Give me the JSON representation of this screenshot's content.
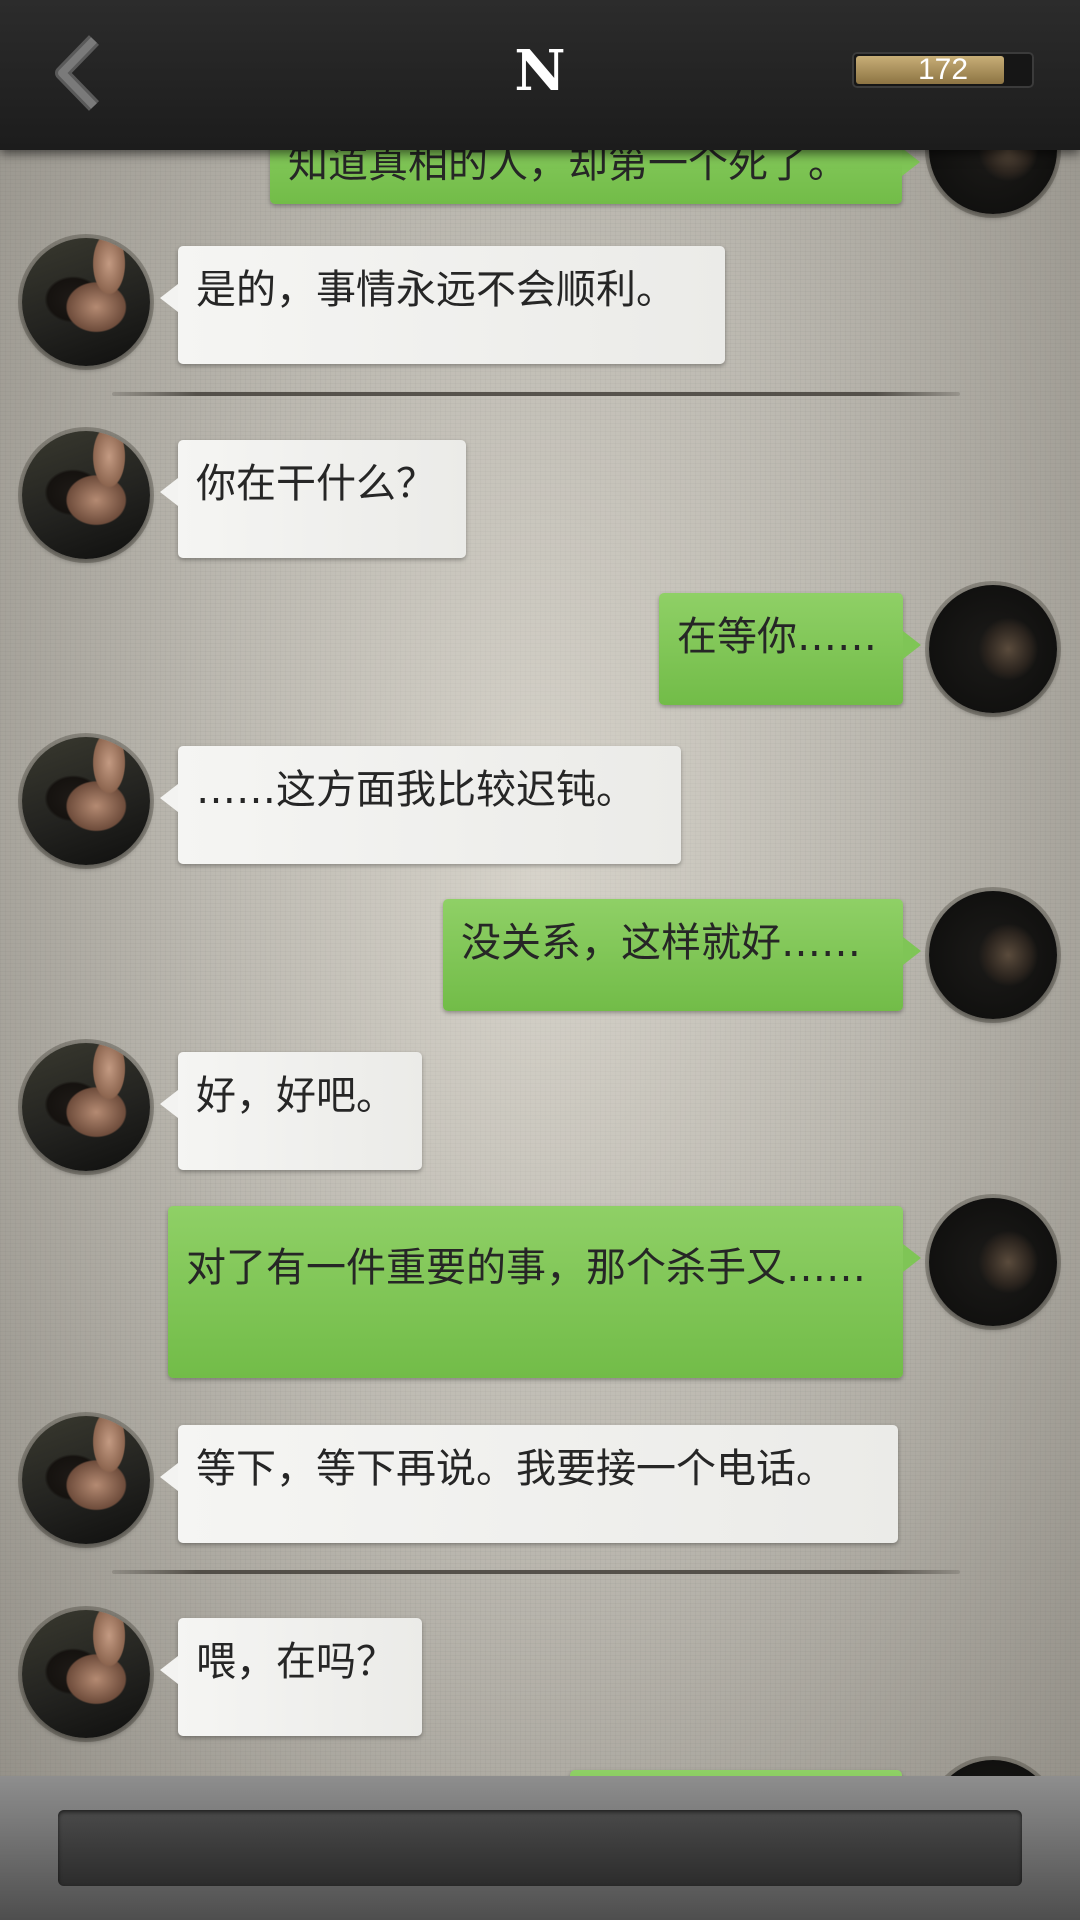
{
  "header": {
    "title": "N",
    "counter_value": "172",
    "counter_fill_fraction": 0.85
  },
  "chat": {
    "partial_top_text": "知道真相的人，却第一个死了。",
    "messages": [
      {
        "from": "him",
        "text": "是的，事情永远不会顺利。"
      },
      {
        "from": "him",
        "text": "你在干什么？"
      },
      {
        "from": "her",
        "text": "在等你……"
      },
      {
        "from": "him",
        "text": "……这方面我比较迟钝。"
      },
      {
        "from": "her",
        "text": "没关系，这样就好……"
      },
      {
        "from": "him",
        "text": "好，好吧。"
      },
      {
        "from": "her",
        "text": "对了有一件重要的事，那个杀手又……"
      },
      {
        "from": "him",
        "text": "等下，等下再说。我要接一个电话。"
      },
      {
        "from": "him",
        "text": "喂，在吗？"
      }
    ]
  },
  "icons": {
    "back": "chevron-left-icon"
  },
  "colors": {
    "bubble_green": "#7fc556",
    "bubble_white": "#f0f0ee",
    "topbar": "#222222",
    "counter_gold": "#b09a68"
  }
}
